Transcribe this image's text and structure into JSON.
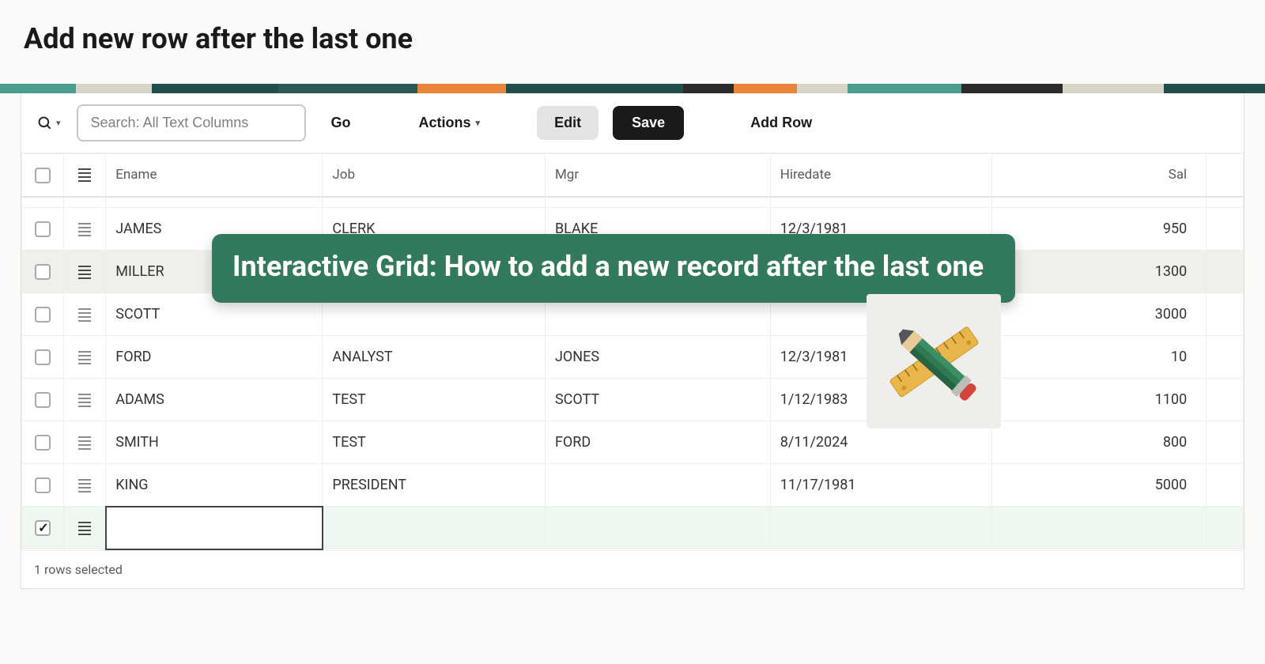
{
  "page": {
    "title": "Add new row after the last one"
  },
  "toolbar": {
    "search_placeholder": "Search: All Text Columns",
    "go": "Go",
    "actions": "Actions",
    "edit": "Edit",
    "save": "Save",
    "add_row": "Add Row"
  },
  "columns": {
    "ename": "Ename",
    "job": "Job",
    "mgr": "Mgr",
    "hiredate": "Hiredate",
    "sal": "Sal"
  },
  "rows": [
    {
      "ename": "JAMES",
      "job": "CLERK",
      "mgr": "BLAKE",
      "hiredate": "12/3/1981",
      "sal": "950",
      "selected": false
    },
    {
      "ename": "MILLER",
      "job": "",
      "mgr": "",
      "hiredate": "",
      "sal": "1300",
      "selected": false,
      "highlight": true
    },
    {
      "ename": "SCOTT",
      "job": "",
      "mgr": "",
      "hiredate": "",
      "sal": "3000",
      "selected": false
    },
    {
      "ename": "FORD",
      "job": "ANALYST",
      "mgr": "JONES",
      "hiredate": "12/3/1981",
      "sal": "10",
      "selected": false
    },
    {
      "ename": "ADAMS",
      "job": "TEST",
      "mgr": "SCOTT",
      "hiredate": "1/12/1983",
      "sal": "1100",
      "selected": false
    },
    {
      "ename": "SMITH",
      "job": "TEST",
      "mgr": "FORD",
      "hiredate": "8/11/2024",
      "sal": "800",
      "selected": false
    },
    {
      "ename": "KING",
      "job": "PRESIDENT",
      "mgr": "",
      "hiredate": "11/17/1981",
      "sal": "5000",
      "selected": false
    }
  ],
  "new_row": {
    "ename": "",
    "job": "",
    "mgr": "",
    "hiredate": "",
    "sal": "",
    "selected": true
  },
  "footer": {
    "status": "1 rows selected"
  },
  "overlay": {
    "title": "Interactive Grid: How to add a new record after the last one"
  },
  "colors": {
    "banner": "#327a5b",
    "save_btn": "#1a1a1a",
    "edit_btn": "#e4e4e2",
    "newrow_bg": "#eef8f0"
  }
}
